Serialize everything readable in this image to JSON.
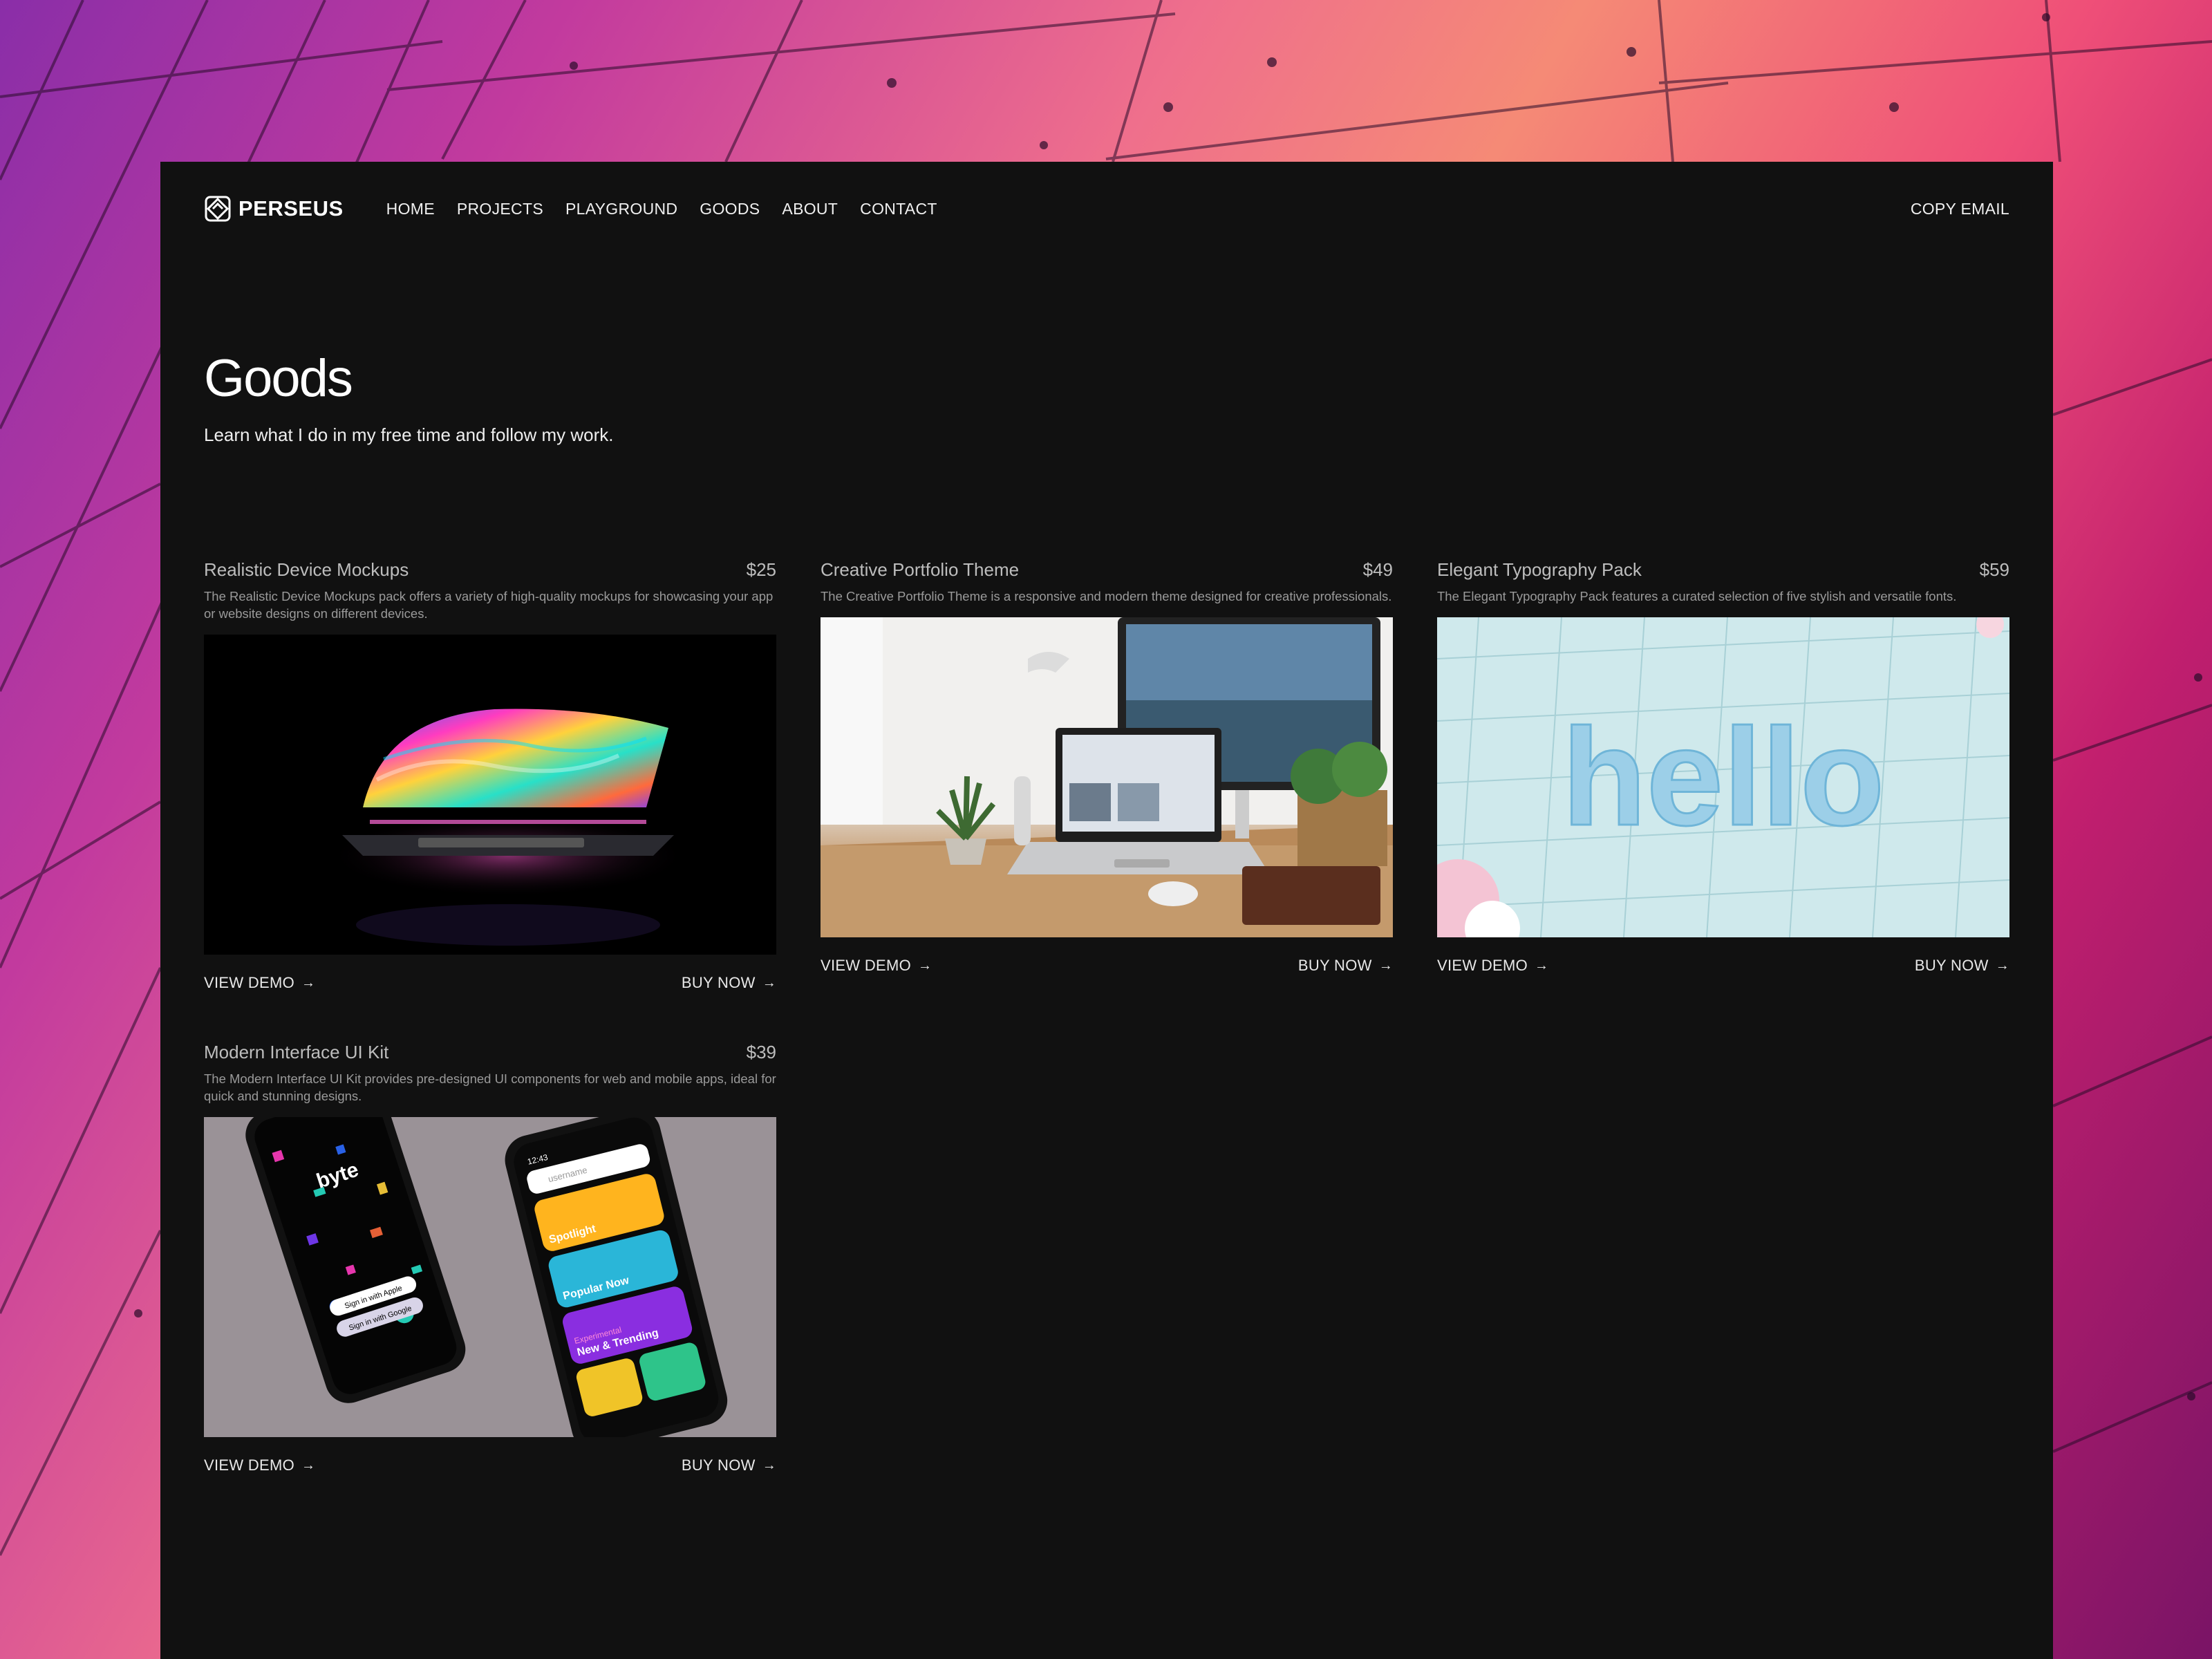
{
  "brand": {
    "name": "PERSEUS",
    "logo_icon": "perseus-logo-icon"
  },
  "nav": {
    "items": [
      {
        "label": "HOME"
      },
      {
        "label": "PROJECTS"
      },
      {
        "label": "PLAYGROUND"
      },
      {
        "label": "GOODS"
      },
      {
        "label": "ABOUT"
      },
      {
        "label": "CONTACT"
      }
    ],
    "copy_email": "COPY EMAIL"
  },
  "page": {
    "title": "Goods",
    "subtitle": "Learn what I do in my free time and follow my work."
  },
  "products": [
    {
      "title": "Realistic Device Mockups",
      "price": "$25",
      "description": "The Realistic Device Mockups pack offers a variety of high-quality mockups for showcasing your app or website designs on different devices.",
      "image": "laptop-with-colorful-screen",
      "view_demo": "VIEW DEMO",
      "buy_now": "BUY NOW"
    },
    {
      "title": "Creative Portfolio Theme",
      "price": "$49",
      "description": "The Creative Portfolio Theme is a responsive and modern theme designed for creative professionals.",
      "image": "desk-with-laptop-and-monitor",
      "view_demo": "VIEW DEMO",
      "buy_now": "BUY NOW"
    },
    {
      "title": "Elegant Typography Pack",
      "price": "$59",
      "description": "The Elegant Typography Pack features a curated selection of five stylish and versatile fonts.",
      "image": "3d-hello-letters",
      "image_text": "hello",
      "view_demo": "VIEW DEMO",
      "buy_now": "BUY NOW"
    },
    {
      "title": "Modern Interface UI Kit",
      "price": "$39",
      "description": "The Modern Interface UI Kit provides pre-designed UI components for web and mobile apps, ideal for quick and stunning designs.",
      "image": "two-smartphones-app-screens",
      "phone_left": {
        "app": "byte",
        "btn_apple": "Sign in with Apple",
        "btn_google": "Sign in with Google"
      },
      "phone_right": {
        "time": "12:43",
        "search": "username",
        "cards": [
          "Spotlight",
          "Popular Now",
          "Experimental",
          "New & Trending"
        ]
      },
      "view_demo": "VIEW DEMO",
      "buy_now": "BUY NOW"
    }
  ],
  "colors": {
    "page_bg": "#111111",
    "text": "#f2f2f2",
    "muted": "#9a9a9a"
  }
}
